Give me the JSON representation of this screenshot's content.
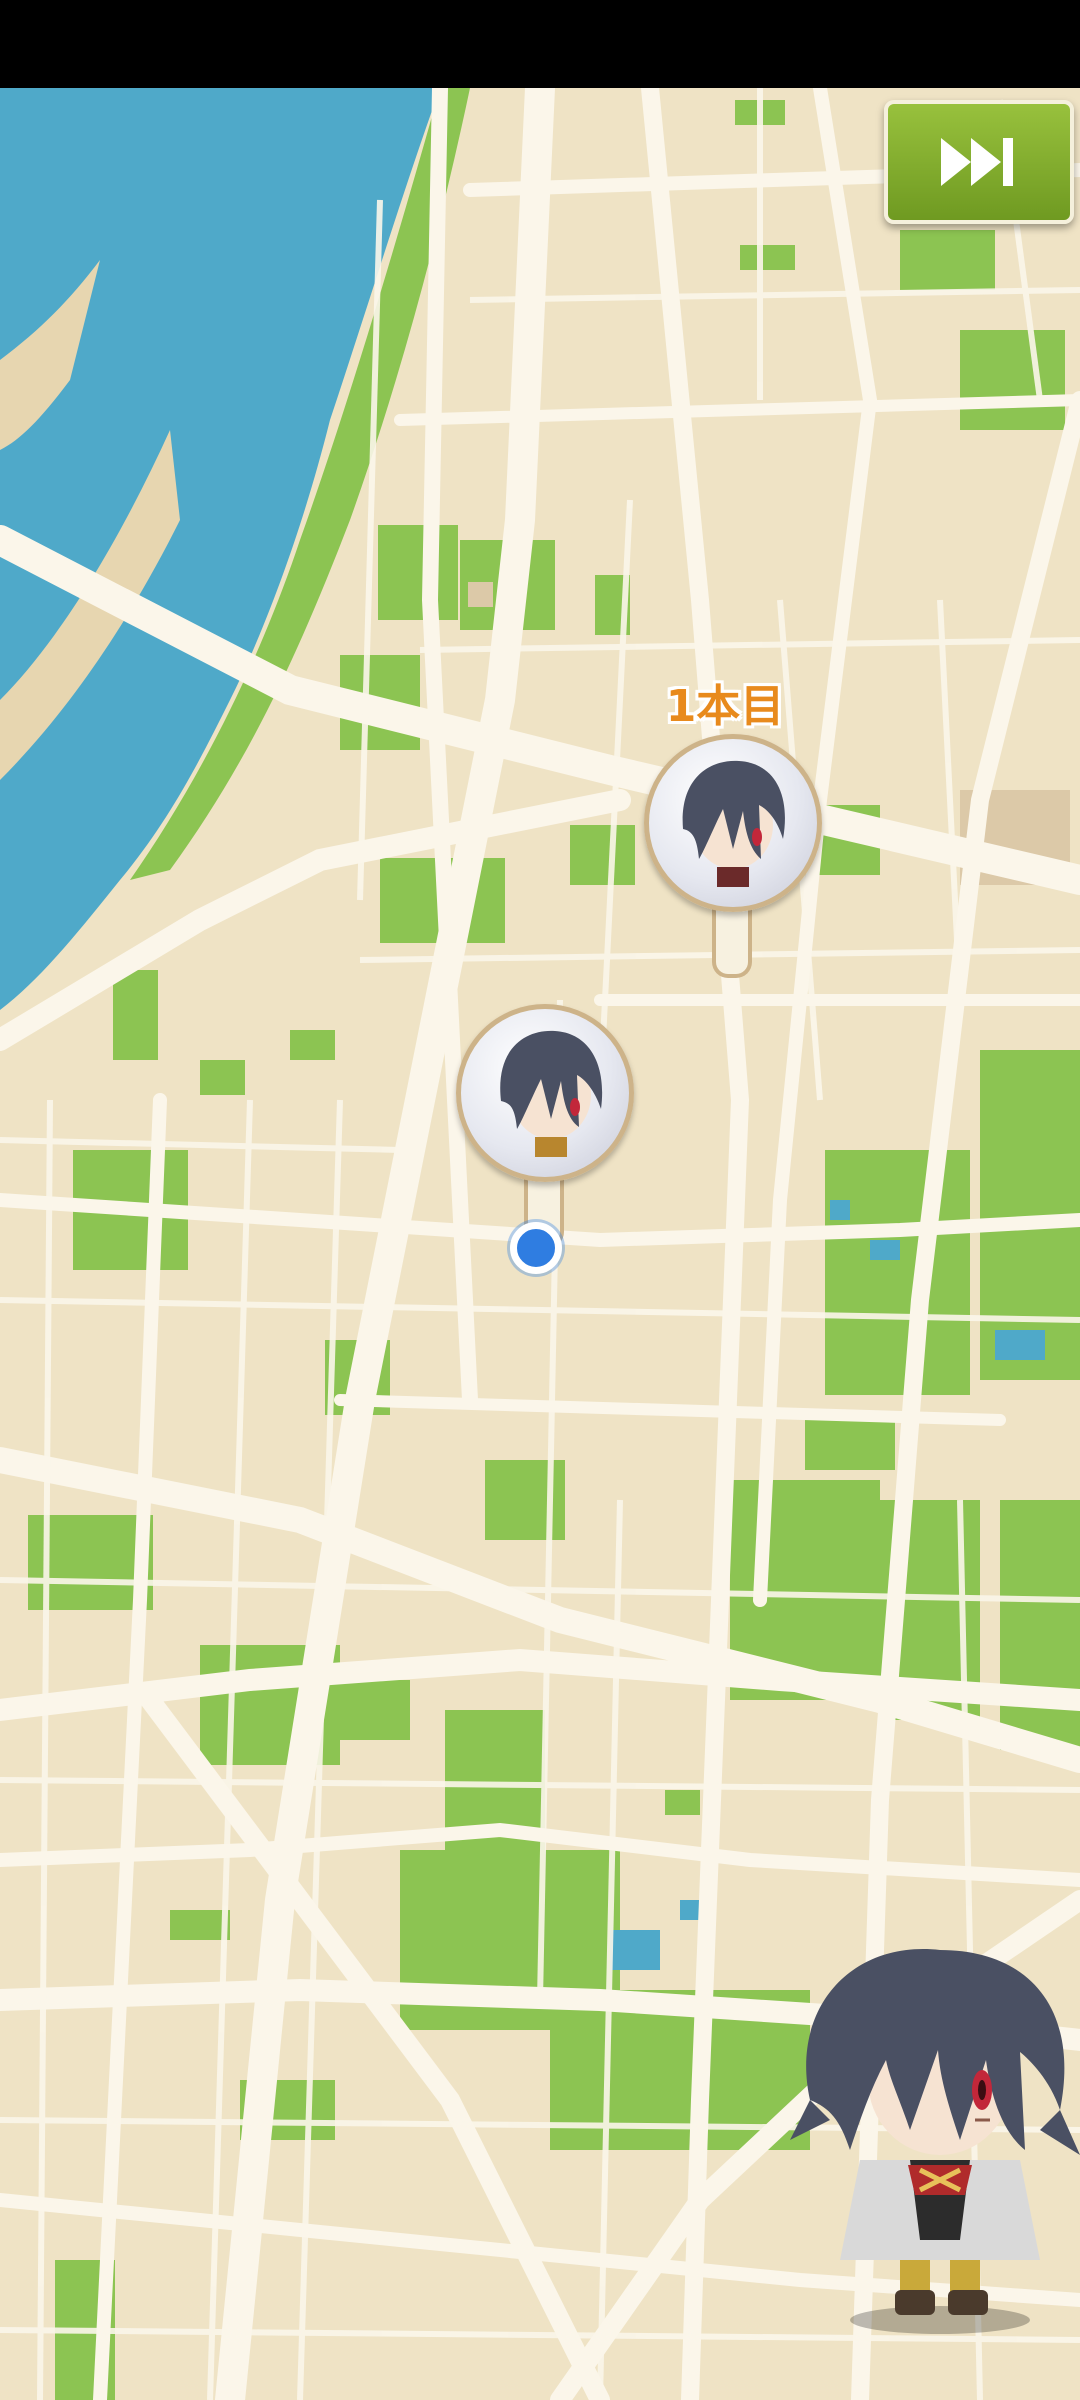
{
  "screen": {
    "status_bar_color": "#000000",
    "map": {
      "land_color": "#efe3c5",
      "road_color": "#fbf6ea",
      "park_color": "#8cc452",
      "water_color": "#4fa9c9"
    }
  },
  "skip_button": {
    "icon": "fast-forward-icon",
    "accent": "#8bb534"
  },
  "pins": [
    {
      "label": "1本目",
      "icon": "character-avatar-icon"
    },
    {
      "label": "",
      "icon": "character-avatar-icon"
    }
  ],
  "current_location": {
    "icon": "location-dot-icon",
    "color": "#2f7de1"
  },
  "character": {
    "icon": "chibi-swordsman-icon"
  }
}
